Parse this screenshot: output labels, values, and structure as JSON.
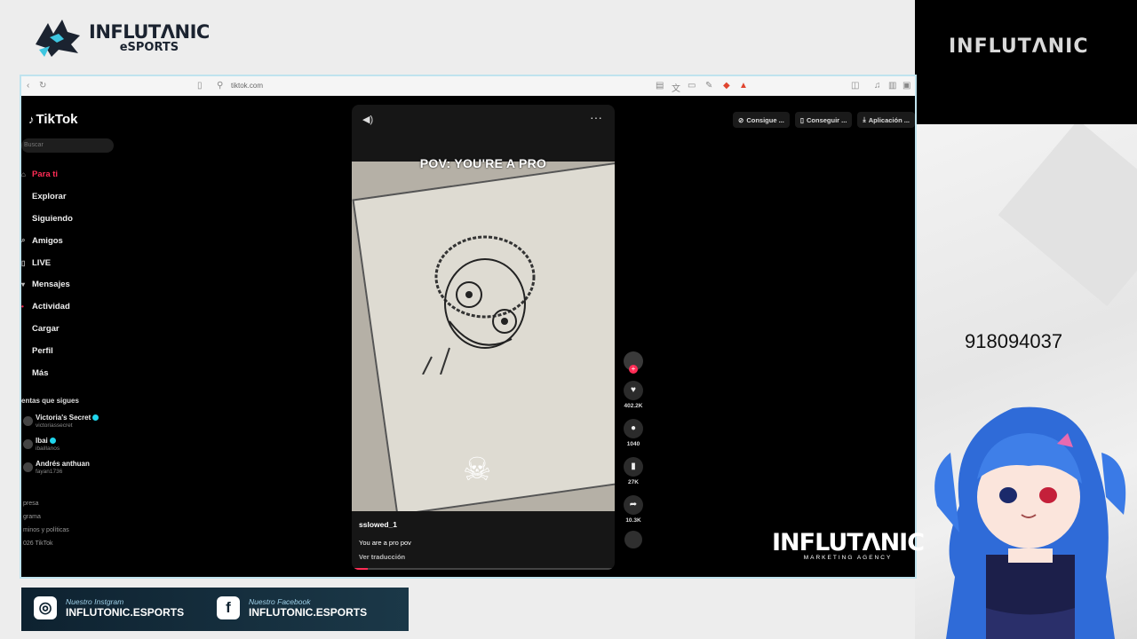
{
  "stream": {
    "brand": {
      "line1": "INFLUTΛNIC",
      "line2": "eSPORTS"
    },
    "cam_label": "INFLUTΛNIC",
    "phone": "918094037",
    "agency": {
      "line1": "INFLUTΛNIC",
      "line2": "MARKETING AGENCY"
    },
    "social": [
      {
        "label": "Nuestro Instgram",
        "handle": "INFLUTONIC.ESPORTS",
        "icon": "instagram-icon"
      },
      {
        "label": "Nuestro Facebook",
        "handle": "INFLUTONIC.ESPORTS",
        "icon": "facebook-icon"
      }
    ]
  },
  "browser": {
    "url": "tiktok.com"
  },
  "tiktok": {
    "logo": "TikTok",
    "search_placeholder": "Buscar",
    "nav": [
      {
        "label": "Para ti",
        "icon": "home-icon"
      },
      {
        "label": "Explorar",
        "icon": "compass-icon"
      },
      {
        "label": "Siguiendo",
        "icon": "following-icon"
      },
      {
        "label": "Amigos",
        "icon": "friends-icon"
      },
      {
        "label": "LIVE",
        "icon": "live-icon"
      },
      {
        "label": "Mensajes",
        "icon": "messages-icon"
      },
      {
        "label": "Actividad",
        "icon": "activity-icon"
      },
      {
        "label": "Cargar",
        "icon": "upload-icon"
      },
      {
        "label": "Perfil",
        "icon": "profile-icon"
      },
      {
        "label": "Más",
        "icon": "more-icon"
      }
    ],
    "following_header": "entas que sigues",
    "accounts": [
      {
        "name": "Victoria's Secret",
        "handle": "victoriassecret",
        "verified": true
      },
      {
        "name": "Ibai",
        "handle": "ibaillanos",
        "verified": true
      },
      {
        "name": "Andrés anthuan",
        "handle": "fayan1736",
        "verified": false
      }
    ],
    "footer": [
      "presa",
      "grama",
      "minos y políticas",
      "026 TikTok"
    ],
    "top_buttons": [
      "Consigue ...",
      "Conseguir ...",
      "Aplicación ..."
    ],
    "video": {
      "overlay": "POV: YOU'RE A PRO",
      "username": "sslowed_1",
      "description": "You are a pro pov",
      "translate": "Ver traducción",
      "likes": "402.2K",
      "comments": "1040",
      "saves": "27K",
      "shares": "10.3K",
      "progress": 0.06
    }
  }
}
